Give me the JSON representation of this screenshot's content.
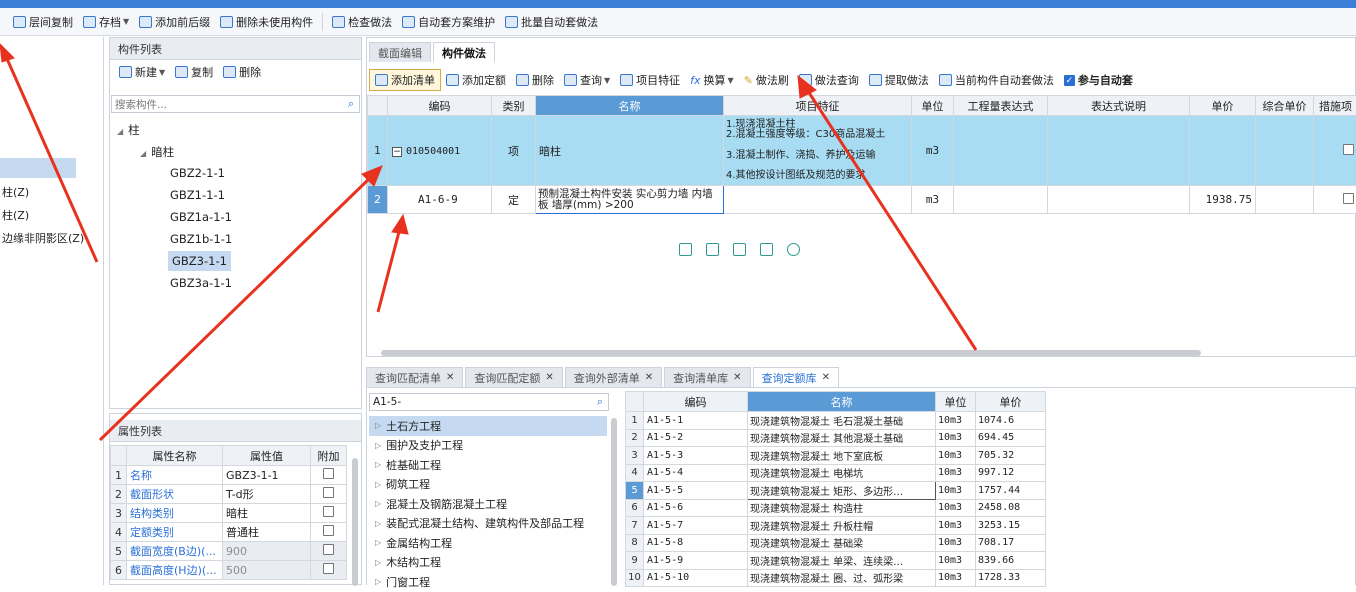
{
  "toolbar": {
    "items": [
      "层间复制",
      "存档",
      "添加前后缀",
      "删除未使用构件",
      "检查做法",
      "自动套方案维护",
      "批量自动套做法"
    ]
  },
  "left_panel": {
    "lines": [
      "柱(Z)",
      "柱(Z)",
      "边缘非阴影区(Z)"
    ]
  },
  "component_list": {
    "title": "构件列表",
    "new_label": "新建",
    "copy_label": "复制",
    "delete_label": "删除",
    "search_placeholder": "搜索构件...",
    "tree": {
      "root": "柱",
      "child": "暗柱",
      "items": [
        "GBZ2-1-1",
        "GBZ1-1-1",
        "GBZ1a-1-1",
        "GBZ1b-1-1",
        "GBZ3-1-1",
        "GBZ3a-1-1"
      ],
      "selected": "GBZ3-1-1"
    }
  },
  "properties": {
    "title": "属性列表",
    "headers": [
      "属性名称",
      "属性值",
      "附加"
    ],
    "rows": [
      {
        "n": "1",
        "name": "名称",
        "value": "GBZ3-1-1"
      },
      {
        "n": "2",
        "name": "截面形状",
        "value": "T-d形"
      },
      {
        "n": "3",
        "name": "结构类别",
        "value": "暗柱"
      },
      {
        "n": "4",
        "name": "定额类别",
        "value": "普通柱"
      },
      {
        "n": "5",
        "name": "截面宽度(B边)(...",
        "value": "900"
      },
      {
        "n": "6",
        "name": "截面高度(H边)(...",
        "value": "500"
      }
    ]
  },
  "main_tabs": [
    "截面编辑",
    "构件做法"
  ],
  "method_toolbar": {
    "items": [
      "添加清单",
      "添加定额",
      "删除",
      "查询",
      "项目特征",
      "换算",
      "做法刷",
      "做法查询",
      "提取做法",
      "当前构件自动套做法",
      "参与自动套"
    ]
  },
  "method_grid": {
    "headers": [
      "编码",
      "类别",
      "名称",
      "项目特征",
      "单位",
      "工程量表达式",
      "表达式说明",
      "单价",
      "综合单价",
      "措施项"
    ],
    "rows": [
      {
        "n": "1",
        "code": "010504001",
        "type": "项",
        "name": "暗柱",
        "features": [
          "1.现浇混凝土柱",
          "2.混凝土强度等级：C30商品混凝土",
          "3.混凝土制作、浇捣、养护及运输",
          "4.其他按设计图纸及规范的要求"
        ],
        "unit": "m3",
        "price": ""
      },
      {
        "n": "2",
        "code": "A1-6-9",
        "type": "定",
        "name": "预制混凝土构件安装 实心剪力墙 内墙板 墙厚(mm) >200",
        "features": [],
        "unit": "m3",
        "price": "1938.75"
      }
    ]
  },
  "query_tabs": [
    "查询匹配清单",
    "查询匹配定额",
    "查询外部清单",
    "查询清单库",
    "查询定额库"
  ],
  "query": {
    "search_value": "A1-5-",
    "categories": [
      "土石方工程",
      "围护及支护工程",
      "桩基础工程",
      "砌筑工程",
      "混凝土及钢筋混凝土工程",
      "装配式混凝土结构、建筑构件及部品工程",
      "金属结构工程",
      "木结构工程",
      "门窗工程"
    ],
    "headers": [
      "编码",
      "名称",
      "单位",
      "单价"
    ],
    "rows": [
      {
        "n": "1",
        "code": "A1-5-1",
        "name": "现浇建筑物混凝土 毛石混凝土基础",
        "unit": "10m3",
        "price": "1074.6"
      },
      {
        "n": "2",
        "code": "A1-5-2",
        "name": "现浇建筑物混凝土 其他混凝土基础",
        "unit": "10m3",
        "price": "694.45"
      },
      {
        "n": "3",
        "code": "A1-5-3",
        "name": "现浇建筑物混凝土 地下室底板",
        "unit": "10m3",
        "price": "705.32"
      },
      {
        "n": "4",
        "code": "A1-5-4",
        "name": "现浇建筑物混凝土 电梯坑",
        "unit": "10m3",
        "price": "997.12"
      },
      {
        "n": "5",
        "code": "A1-5-5",
        "name": "现浇建筑物混凝土 矩形、多边形…",
        "unit": "10m3",
        "price": "1757.44"
      },
      {
        "n": "6",
        "code": "A1-5-6",
        "name": "现浇建筑物混凝土 构造柱",
        "unit": "10m3",
        "price": "2458.08"
      },
      {
        "n": "7",
        "code": "A1-5-7",
        "name": "现浇建筑物混凝土 升板柱帽",
        "unit": "10m3",
        "price": "3253.15"
      },
      {
        "n": "8",
        "code": "A1-5-8",
        "name": "现浇建筑物混凝土 基础梁",
        "unit": "10m3",
        "price": "708.17"
      },
      {
        "n": "9",
        "code": "A1-5-9",
        "name": "现浇建筑物混凝土 单梁、连续梁…",
        "unit": "10m3",
        "price": "839.66"
      },
      {
        "n": "10",
        "code": "A1-5-10",
        "name": "现浇建筑物混凝土 圈、过、弧形梁",
        "unit": "10m3",
        "price": "1728.33"
      }
    ]
  },
  "colors": {
    "accent": "#3d7fd6",
    "selected_row": "#a8dcf2",
    "selected_header": "#5b9bd5",
    "arrow": "#e8321f"
  }
}
